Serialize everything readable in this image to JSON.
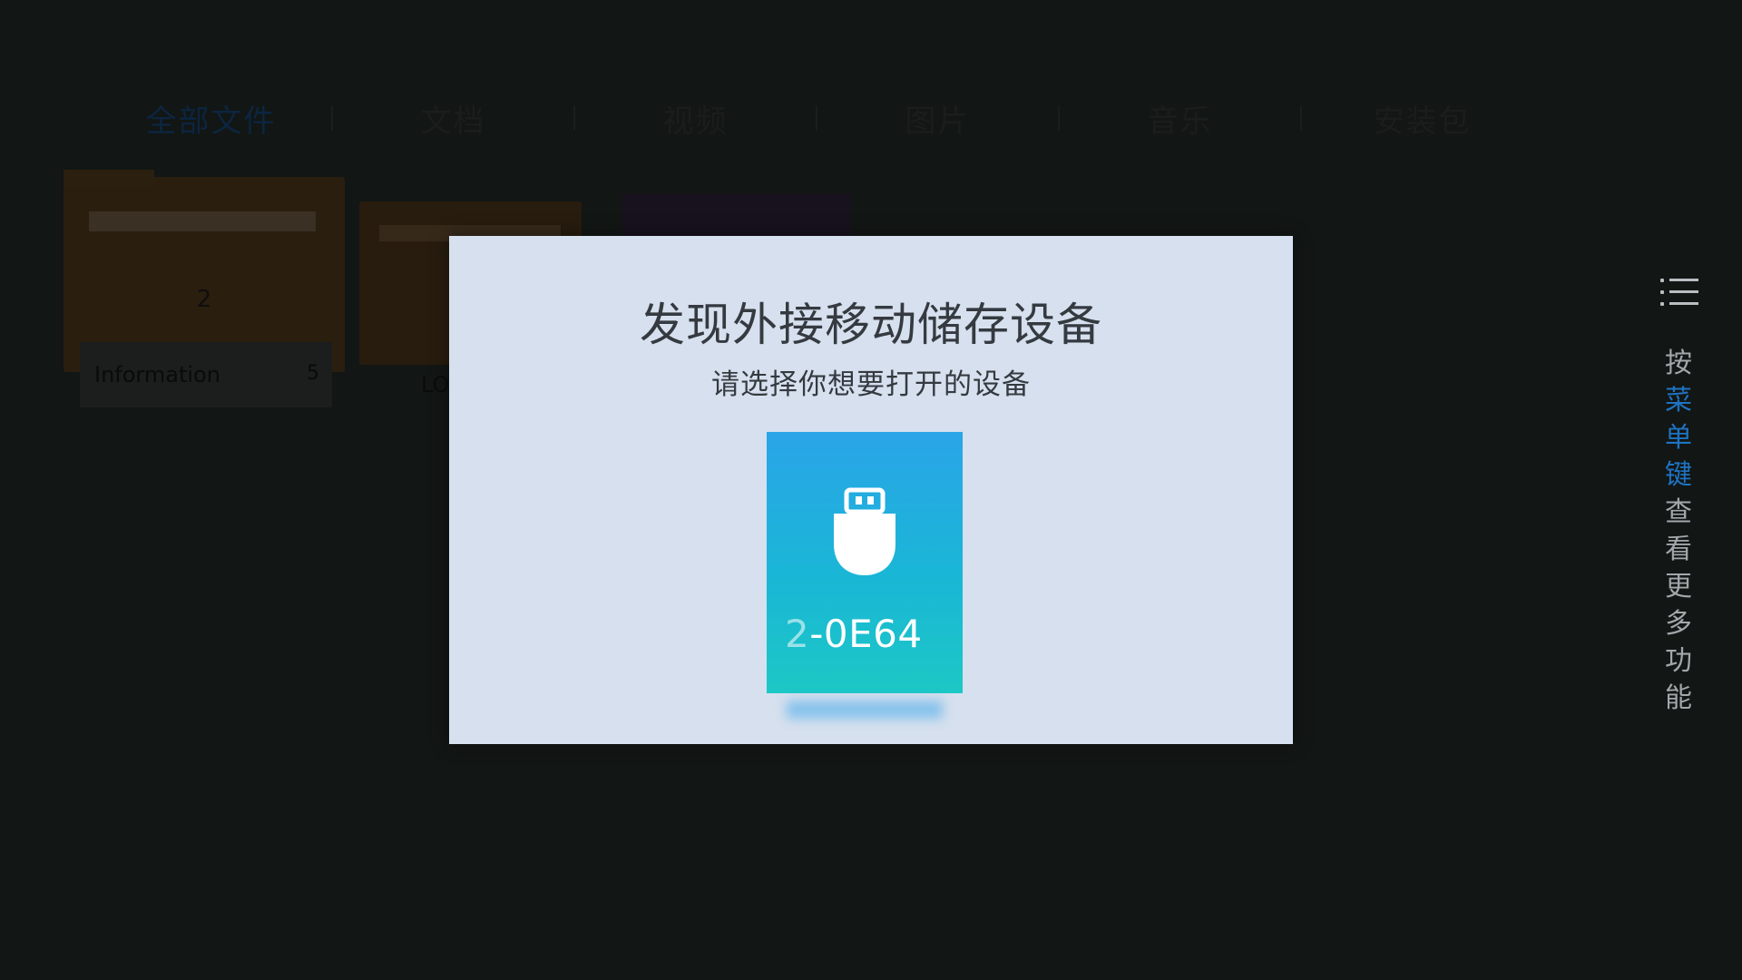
{
  "tabs": [
    {
      "label": "全部文件",
      "active": true
    },
    {
      "label": "文档"
    },
    {
      "label": "视频"
    },
    {
      "label": "图片"
    },
    {
      "label": "音乐"
    },
    {
      "label": "安装包"
    }
  ],
  "files": [
    {
      "name": "Information",
      "count_badge": "2",
      "count_side": "5"
    },
    {
      "name": "LO"
    }
  ],
  "side_hint": {
    "chars": [
      "按",
      "菜",
      "单",
      "键",
      "查",
      "看",
      "更",
      "多",
      "功",
      "能"
    ],
    "highlight_color": "#1f73c2"
  },
  "dialog": {
    "title": "发现外接移动储存设备",
    "subtitle": "请选择你想要打开的设备",
    "device": {
      "name_prefix": "2",
      "name_rest": "-0E64",
      "icon": "usb-drive-icon"
    }
  },
  "colors": {
    "dialog_bg": "#d6e0ee",
    "card_top": "#2aa5e8",
    "card_bottom": "#1cc8c5"
  }
}
